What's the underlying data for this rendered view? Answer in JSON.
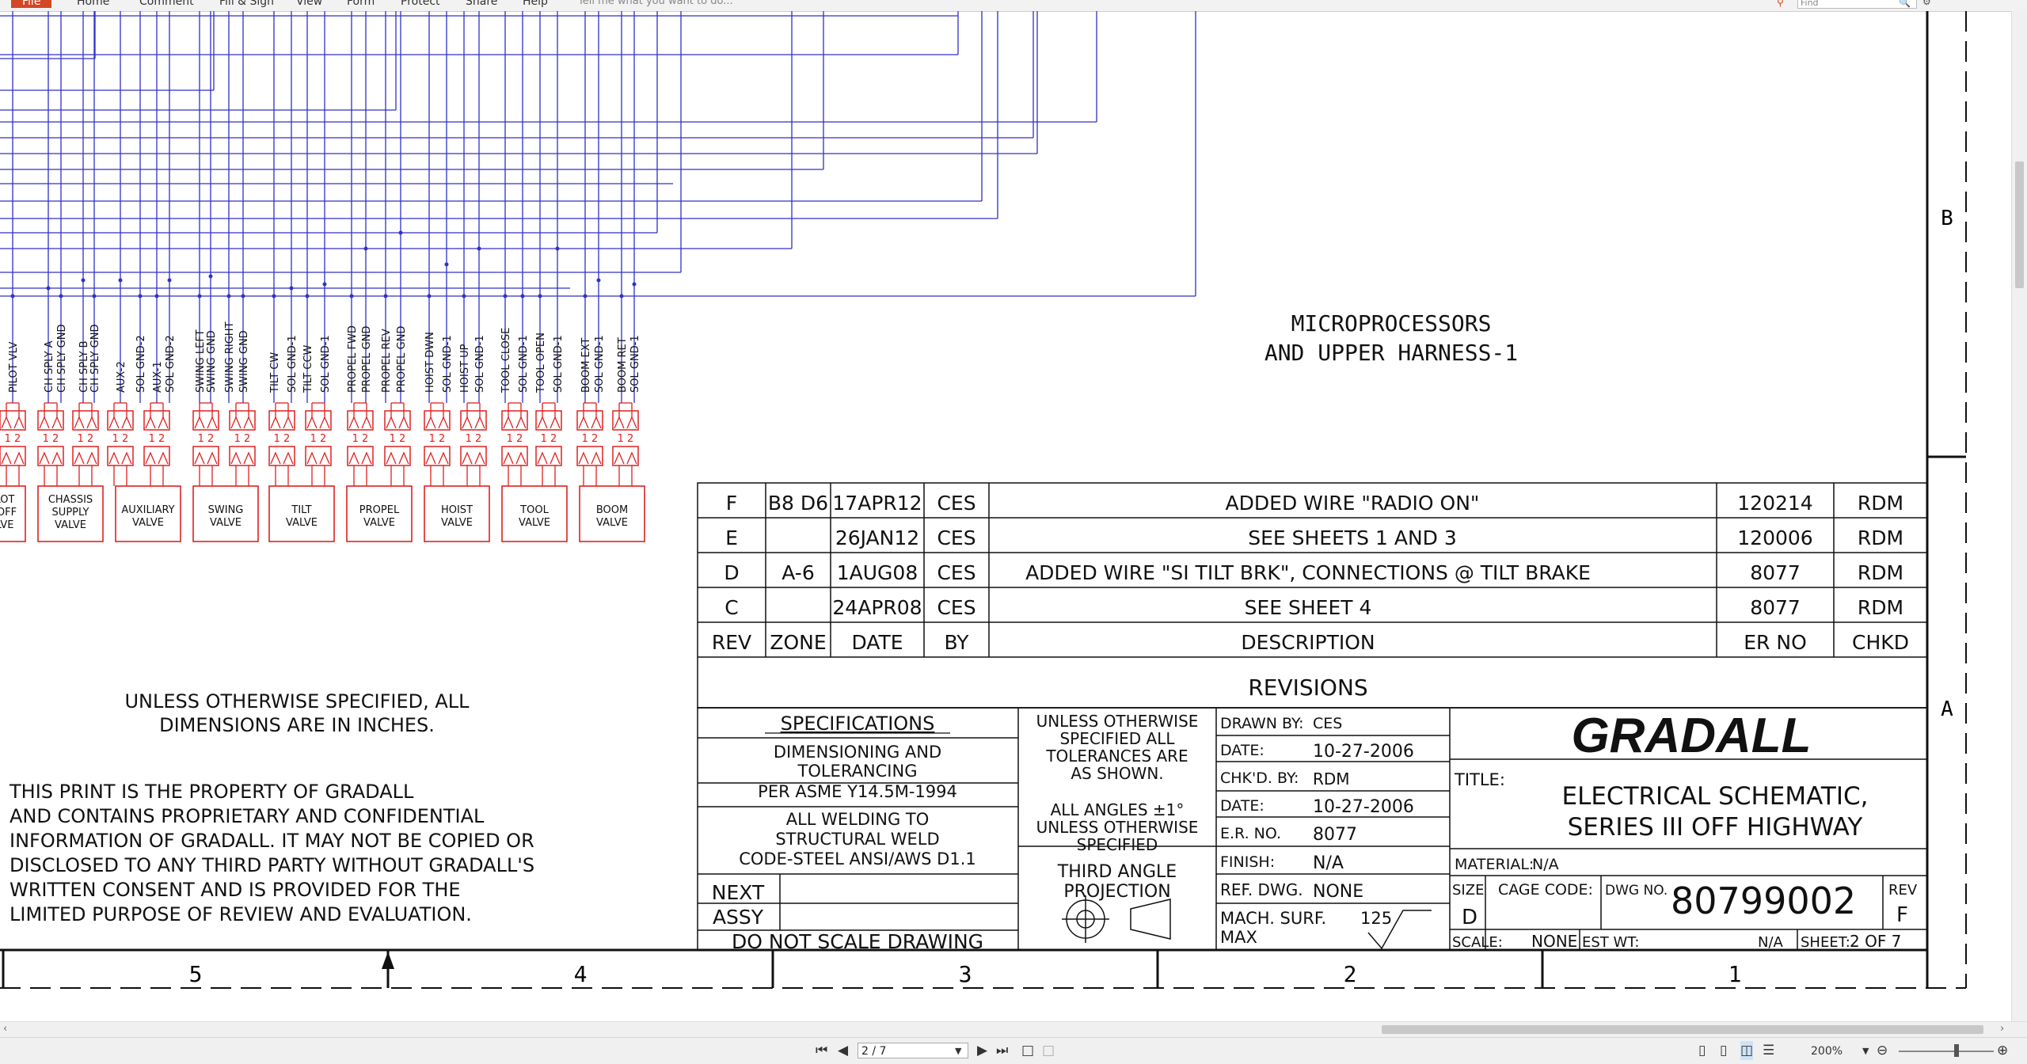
{
  "menu": {
    "items": [
      "File",
      "Home",
      "Comment",
      "Fill & Sign",
      "View",
      "Form",
      "Protect",
      "Share",
      "Help"
    ],
    "active": "File",
    "tell_me": "Tell me what you want to do...",
    "find_placeholder": "Find"
  },
  "wire_labels": [
    "PILOT VLV",
    "CH SPLY A",
    "CH SPLY GND",
    "CH SPLY B",
    "CH SPLY GND",
    "AUX-2",
    "SOL GND-2",
    "AUX-1",
    "SOL GND-2",
    "SWING LEFT",
    "SWING GND",
    "SWING RIGHT",
    "SWING GND",
    "TILT CW",
    "SOL GND-1",
    "TILT CCW",
    "SOL GND-1",
    "PROPEL FWD",
    "PROPEL GND",
    "PROPEL REV",
    "PROPEL GND",
    "HOIST DWN",
    "SOL GND-1",
    "HOIST UP",
    "SOL GND-1",
    "TOOL CLOSE",
    "SOL GND-1",
    "TOOL OPEN",
    "SOL GND-1",
    "BOOM EXT",
    "SOL GND-1",
    "BOOM RET",
    "SOL GND-1"
  ],
  "pin_label": "1 2",
  "valves": [
    {
      "line1": "LOT",
      "line2": "-OFF",
      "line3": "LVE"
    },
    {
      "line1": "CHASSIS",
      "line2": "SUPPLY",
      "line3": "VALVE"
    },
    {
      "line1": "AUXILIARY",
      "line2": "VALVE",
      "line3": ""
    },
    {
      "line1": "SWING",
      "line2": "VALVE",
      "line3": ""
    },
    {
      "line1": "TILT",
      "line2": "VALVE",
      "line3": ""
    },
    {
      "line1": "PROPEL",
      "line2": "VALVE",
      "line3": ""
    },
    {
      "line1": "HOIST",
      "line2": "VALVE",
      "line3": ""
    },
    {
      "line1": "TOOL",
      "line2": "VALVE",
      "line3": ""
    },
    {
      "line1": "BOOM",
      "line2": "VALVE",
      "line3": ""
    }
  ],
  "sheet_title": {
    "line1": "MICROPROCESSORS",
    "line2": "AND UPPER HARNESS-1"
  },
  "zones_right": {
    "b": "B",
    "a": "A"
  },
  "zones_bottom": [
    "5",
    "4",
    "3",
    "2",
    "1"
  ],
  "revisions": {
    "rows": [
      {
        "rev": "F",
        "zone": "B8 D6",
        "date": "17APR12",
        "by": "CES",
        "desc": "ADDED WIRE \"RADIO ON\"",
        "er": "120214",
        "chkd": "RDM"
      },
      {
        "rev": "E",
        "zone": "",
        "date": "26JAN12",
        "by": "CES",
        "desc": "SEE SHEETS 1 AND 3",
        "er": "120006",
        "chkd": "RDM"
      },
      {
        "rev": "D",
        "zone": "A-6",
        "date": "1AUG08",
        "by": "CES",
        "desc": "ADDED WIRE \"SI TILT BRK\", CONNECTIONS @ TILT BRAKE",
        "er": "8077",
        "chkd": "RDM"
      },
      {
        "rev": "C",
        "zone": "",
        "date": "24APR08",
        "by": "CES",
        "desc": "SEE SHEET 4",
        "er": "8077",
        "chkd": "RDM"
      }
    ],
    "headers": {
      "rev": "REV",
      "zone": "ZONE",
      "date": "DATE",
      "by": "BY",
      "desc": "DESCRIPTION",
      "er": "ER NO",
      "chkd": "CHKD"
    },
    "title": "REVISIONS"
  },
  "notes": {
    "dims_line1": "UNLESS OTHERWISE SPECIFIED, ALL",
    "dims_line2": "DIMENSIONS ARE IN INCHES.",
    "prop_lines": [
      "THIS PRINT IS THE PROPERTY OF GRADALL",
      "AND CONTAINS PROPRIETARY AND CONFIDENTIAL",
      "INFORMATION OF GRADALL. IT MAY NOT BE COPIED OR",
      "DISCLOSED TO ANY THIRD PARTY WITHOUT GRADALL'S",
      "WRITTEN CONSENT AND IS PROVIDED FOR THE",
      "LIMITED PURPOSE OF REVIEW AND EVALUATION."
    ]
  },
  "specs": {
    "title": "SPECIFICATIONS",
    "l1": "DIMENSIONING AND",
    "l2": "TOLERANCING",
    "l3": "PER ASME Y14.5M-1994",
    "l4": "ALL WELDING TO",
    "l5": "STRUCTURAL WELD",
    "l6": "CODE-STEEL ANSI/AWS D1.1",
    "next": "NEXT",
    "assy": "ASSY",
    "noscale": "DO NOT SCALE DRAWING"
  },
  "tolerance": {
    "l1": "UNLESS OTHERWISE",
    "l2": "SPECIFIED ALL",
    "l3": "TOLERANCES ARE",
    "l4": "AS SHOWN.",
    "l5": "ALL ANGLES ±1°",
    "l6": "UNLESS OTHERWISE",
    "l7": "SPECIFIED",
    "proj1": "THIRD ANGLE",
    "proj2": "PROJECTION"
  },
  "drawn": {
    "drawn_by_label": "DRAWN BY:",
    "drawn_by": "CES",
    "date_label": "DATE:",
    "date1": "10-27-2006",
    "chkd_label": "CHK'D. BY:",
    "chkd_by": "RDM",
    "date2": "10-27-2006",
    "er_label": "E.R. NO.",
    "er": "8077",
    "finish_label": "FINISH:",
    "finish": "N/A",
    "ref_label": "REF. DWG.",
    "ref": "NONE",
    "mach_label": "MACH. SURF.",
    "mach_max": "MAX",
    "mach_val": "125"
  },
  "titleblock": {
    "logo": "GRADALL",
    "title_label": "TITLE:",
    "title1": "ELECTRICAL SCHEMATIC,",
    "title2": "SERIES III OFF HIGHWAY",
    "material_label": "MATERIAL:",
    "material": "N/A",
    "size_label": "SIZE",
    "size": "D",
    "cage_label": "CAGE CODE:",
    "dwg_label": "DWG NO.",
    "dwg": "80799002",
    "rev_label": "REV",
    "rev": "F",
    "scale_label": "SCALE:",
    "scale": "NONE",
    "wt_label": "EST WT:",
    "wt": "N/A",
    "sheet_label": "SHEET:",
    "sheet": "2 OF 7"
  },
  "status": {
    "page": "2 / 7",
    "zoom": "200%"
  },
  "colors": {
    "wire": "#3030c8",
    "connector": "#e02020",
    "accent": "#d24726"
  }
}
